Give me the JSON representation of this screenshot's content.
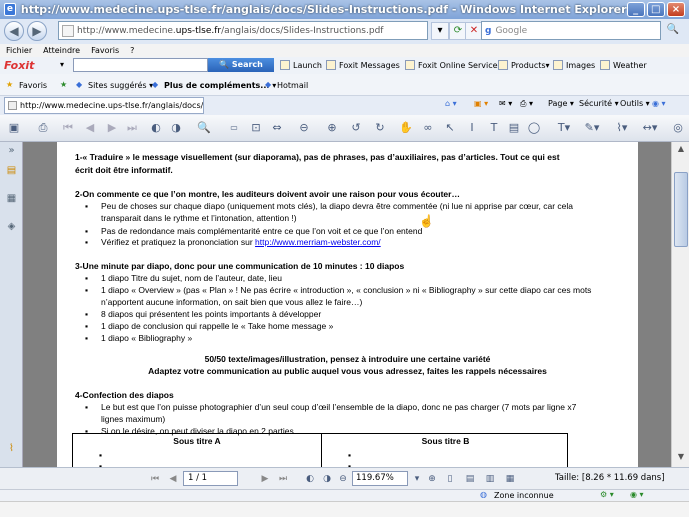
{
  "window": {
    "title": "http://www.medecine.ups-tlse.fr/anglais/docs/Slides-Instructions.pdf - Windows Internet Explorer",
    "min": "_",
    "max": "□",
    "close": "×"
  },
  "nav": {
    "address_prefix": "http://www.medecine.",
    "address_domain": "ups-tlse.fr",
    "address_suffix": "/anglais/docs/Slides-Instructions.pdf",
    "search_placeholder": "Google"
  },
  "menu": [
    "Fichier",
    "Atteindre",
    "Favoris",
    "?"
  ],
  "foxit": {
    "logo": "Foxit",
    "search_label": "Search",
    "links": [
      "Launch",
      "Foxit Messages",
      "Foxit Online Services",
      "Products",
      "Images",
      "Weather"
    ]
  },
  "favorites": {
    "label": "Favoris",
    "items": [
      "Sites suggérés",
      "Plus de compléments...",
      "Hotmail"
    ]
  },
  "tab": {
    "title": "http://www.medecine.ups-tlse.fr/anglais/docs/Slides-...",
    "tools": [
      "Page",
      "Sécurité",
      "Outils"
    ]
  },
  "doc": {
    "s1_line1": "1-« Traduire » le message visuellement (sur diaporama), pas de phrases, pas d’auxiliaires, pas d’articles. Tout ce qui est",
    "s1_line2": "écrit doit être informatif.",
    "s2_title": "2-On commente ce que l’on montre, les auditeurs doivent avoir une raison pour vous écouter…",
    "s2_b1_l1": "Peu de choses sur chaque diapo (uniquement mots clés), la diapo devra être commentée (ni lue ni apprise par cœur, car cela",
    "s2_b1_l2": "transparait dans le rythme et l’intonation, attention !)",
    "s2_b2": "Pas de redondance mais complémentarité entre ce que l’on voit et ce que l’on entend",
    "s2_b3_text": "Vérifiez et pratiquez la prononciation sur ",
    "s2_b3_link": "http://www.merriam-webster.com/",
    "s3_title": "3-Une minute par diapo, donc pour une communication de 10 minutes : 10 diapos",
    "s3_b1": "1 diapo Titre du sujet, nom de l’auteur, date, lieu",
    "s3_b2_l1": "1 diapo « Overview » (pas « Plan » ! Ne pas écrire « introduction », « conclusion » ni « Bibliography » sur cette diapo car ces mots",
    "s3_b2_l2": "n’apportent aucune information, on sait bien que vous allez le faire…)",
    "s3_b3": "8 diapos qui présentent les points importants à développer",
    "s3_b4": "1 diapo de conclusion qui rappelle le « Take home message »",
    "s3_b5": "1 diapo « Bibliography »",
    "center1": "50/50 texte/images/illustration, pensez à introduire une certaine variété",
    "center2": "Adaptez votre communication au public auquel vous vous adressez, faites les rappels nécessaires",
    "s4_title": "4-Confection des diapos",
    "s4_b1_l1": "Le but est que l’on puisse photographier d’un seul coup d’œil l’ensemble de la diapo, donc ne pas charger (7 mots par ligne x7",
    "s4_b1_l2": "lignes maximum)",
    "s4_b2": "Si on le désire, on peut diviser la diapo en 2 parties",
    "table_h1": "Sous titre A",
    "table_h2": "Sous titre B"
  },
  "pdfstatus": {
    "page": "1 / 1",
    "zoom": "119.67%",
    "size": "Taille: [8.26 * 11.69 dans]"
  },
  "iestatus": {
    "zone": "Zone inconnue"
  }
}
